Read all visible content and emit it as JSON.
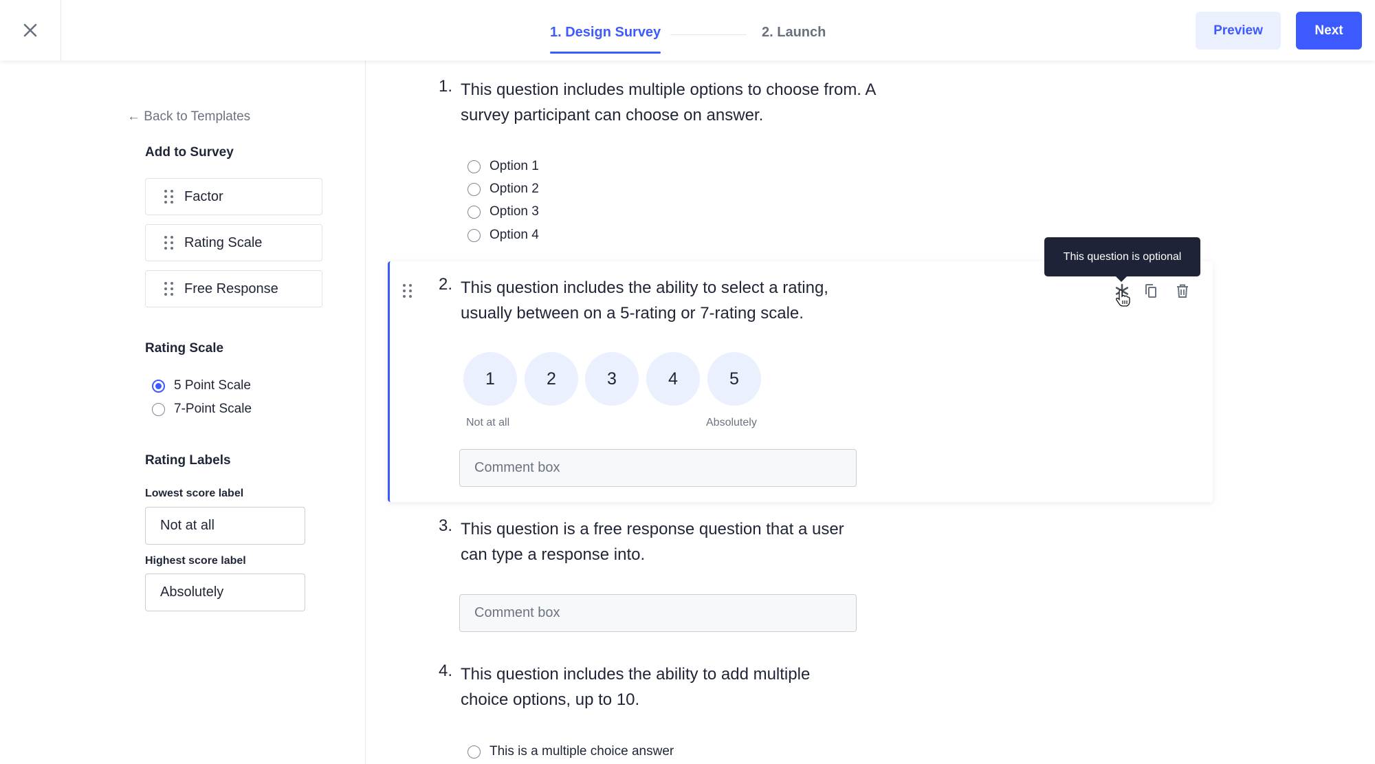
{
  "header": {
    "close_icon": "close-icon",
    "tabs": [
      {
        "label": "1. Design Survey",
        "active": true
      },
      {
        "label": "2. Launch",
        "active": false
      }
    ],
    "preview_label": "Preview",
    "next_label": "Next"
  },
  "colors": {
    "accent": "#3d5afe",
    "accent_light": "#eaf0fd",
    "text": "#1f2537",
    "muted": "#6b7380",
    "tooltip_bg": "#1e2338"
  },
  "sidebar": {
    "back_link": "← Back to Templates",
    "add_title": "Add to Survey",
    "add_items": [
      {
        "label": "Factor",
        "icon": "drag-handle-icon"
      },
      {
        "label": "Rating Scale",
        "icon": "drag-handle-icon"
      },
      {
        "label": "Free Response",
        "icon": "drag-handle-icon"
      }
    ],
    "rating_scale_title": "Rating Scale",
    "scale_options": [
      {
        "label": "5 Point Scale",
        "checked": true
      },
      {
        "label": "7-Point Scale",
        "checked": false
      }
    ],
    "rating_labels_title": "Rating Labels",
    "lowest_label": "Lowest score label",
    "lowest_value": "Not at all",
    "highest_label": "Highest score label",
    "highest_value": "Absolutely"
  },
  "questions": [
    {
      "number": "1.",
      "line1": "This question includes multiple options to choose from. A",
      "line2": "survey participant can choose on answer.",
      "options": [
        "Option 1",
        "Option 2",
        "Option 3",
        "Option 4"
      ]
    },
    {
      "number": "2.",
      "line1": "This question includes the ability to select a rating,",
      "line2": "usually between on a 5-rating or 7-rating scale.",
      "ratings": [
        "1",
        "2",
        "3",
        "4",
        "5"
      ],
      "low_label": "Not at all",
      "high_label": "Absolutely",
      "comment_placeholder": "Comment box",
      "tooltip": "This question is optional",
      "actions": [
        "asterisk-icon",
        "copy-icon",
        "trash-icon"
      ]
    },
    {
      "number": "3.",
      "line1": "This question is a free response question that a user",
      "line2": "can type a response into.",
      "comment_placeholder": "Comment box"
    },
    {
      "number": "4.",
      "line1": "This question includes the ability to add multiple",
      "line2": "choice options, up to 10.",
      "options": [
        "This is a multiple choice answer"
      ]
    }
  ]
}
